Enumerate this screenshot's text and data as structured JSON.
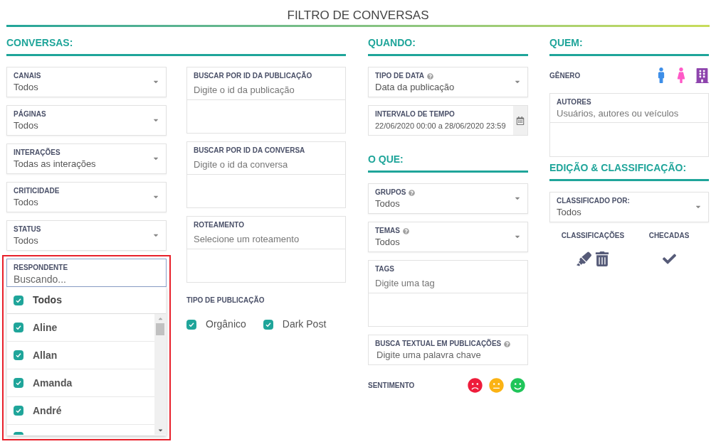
{
  "title": "FILTRO DE CONVERSAS",
  "conversas": {
    "heading": "CONVERSAS:",
    "selects": [
      {
        "label": "CANAIS",
        "value": "Todos"
      },
      {
        "label": "PÁGINAS",
        "value": "Todos"
      },
      {
        "label": "INTERAÇÕES",
        "value": "Todas as interações"
      },
      {
        "label": "CRITICIDADE",
        "value": "Todos"
      },
      {
        "label": "STATUS",
        "value": "Todos"
      }
    ],
    "respondent": {
      "label": "RESPONDENTE",
      "placeholder": "Buscando...",
      "highlighted": true,
      "all": {
        "label": "Todos",
        "checked": true
      },
      "options": [
        {
          "label": "Aline",
          "checked": true
        },
        {
          "label": "Allan",
          "checked": true
        },
        {
          "label": "Amanda",
          "checked": true
        },
        {
          "label": "André",
          "checked": true
        }
      ]
    },
    "searches": [
      {
        "label": "BUSCAR POR ID DA PUBLICAÇÃO",
        "placeholder": "Digite o id da publicação"
      },
      {
        "label": "BUSCAR POR ID DA CONVERSA",
        "placeholder": "Digite o id da conversa"
      },
      {
        "label": "ROTEAMENTO",
        "placeholder": "Selecione um roteamento"
      }
    ],
    "publication_type": {
      "label": "TIPO DE PUBLICAÇÃO",
      "options": [
        {
          "label": "Orgânico",
          "checked": true
        },
        {
          "label": "Dark Post",
          "checked": true
        }
      ]
    }
  },
  "quando": {
    "heading": "QUANDO:",
    "date_type": {
      "label": "TIPO DE DATA",
      "help": true,
      "value": "Data da publicação"
    },
    "interval": {
      "label": "INTERVALO DE TEMPO",
      "value": "22/06/2020 00:00 a 28/06/2020 23:59"
    }
  },
  "o_que": {
    "heading": "O QUE:",
    "selects": [
      {
        "label": "GRUPOS",
        "help": true,
        "value": "Todos"
      },
      {
        "label": "TEMAS",
        "help": true,
        "value": "Todos"
      }
    ],
    "tags": {
      "label": "TAGS",
      "placeholder": "Digite uma tag"
    },
    "text_search": {
      "label": "BUSCA TEXTUAL EM PUBLICAÇÕES",
      "help": true,
      "placeholder": "Digite uma palavra chave"
    },
    "sentiment": {
      "label": "SENTIMENTO"
    }
  },
  "quem": {
    "heading": "QUEM:",
    "gender": {
      "label": "GÊNERO"
    },
    "authors": {
      "label": "AUTORES",
      "placeholder": "Usuários, autores ou veículos"
    }
  },
  "edicao": {
    "heading": "EDIÇÃO & CLASSIFICAÇÃO:",
    "classified_by": {
      "label": "CLASSIFICADO POR:",
      "value": "Todos"
    },
    "classifications": {
      "label": "CLASSIFICAÇÕES"
    },
    "checked": {
      "label": "CHECADAS"
    }
  }
}
